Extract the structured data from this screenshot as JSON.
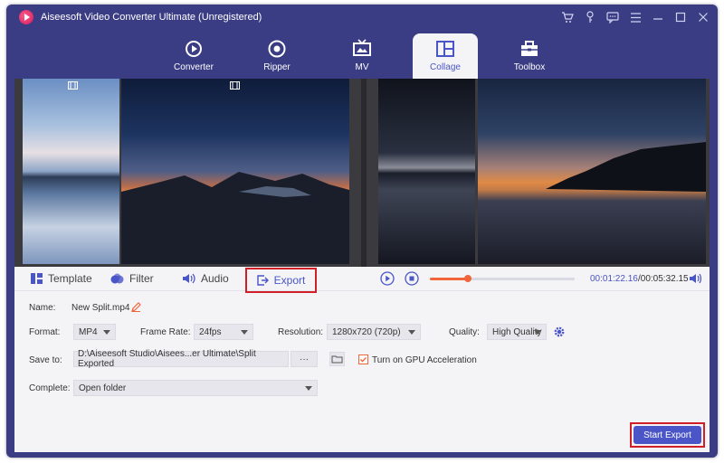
{
  "window": {
    "title": "Aiseesoft Video Converter Ultimate (Unregistered)"
  },
  "nav": {
    "tabs": [
      {
        "label": "Converter",
        "icon": "converter-icon"
      },
      {
        "label": "Ripper",
        "icon": "ripper-icon"
      },
      {
        "label": "MV",
        "icon": "mv-icon"
      },
      {
        "label": "Collage",
        "icon": "collage-icon",
        "active": true
      },
      {
        "label": "Toolbox",
        "icon": "toolbox-icon"
      }
    ]
  },
  "controls": {
    "template_label": "Template",
    "filter_label": "Filter",
    "audio_label": "Audio",
    "export_label": "Export",
    "time_current": "00:01:22.16",
    "time_total": "/00:05:32.15",
    "progress": 0.26
  },
  "form": {
    "name_label": "Name:",
    "name_value": "New Split.mp4",
    "format_label": "Format:",
    "format_value": "MP4",
    "framerate_label": "Frame Rate:",
    "framerate_value": "24fps",
    "resolution_label": "Resolution:",
    "resolution_value": "1280x720 (720p)",
    "quality_label": "Quality:",
    "quality_value": "High Quality",
    "saveto_label": "Save to:",
    "saveto_value": "D:\\Aiseesoft Studio\\Aisees...er Ultimate\\Split Exported",
    "browse_label": "···",
    "gpu_label": "Turn on GPU Acceleration",
    "gpu_checked": true,
    "complete_label": "Complete:",
    "complete_value": "Open folder",
    "start_export_label": "Start Export"
  },
  "colors": {
    "accent": "#4a55c7",
    "titlebar": "#3a3c84",
    "highlight_red": "#d01f27",
    "progress_orange": "#f0663a"
  }
}
